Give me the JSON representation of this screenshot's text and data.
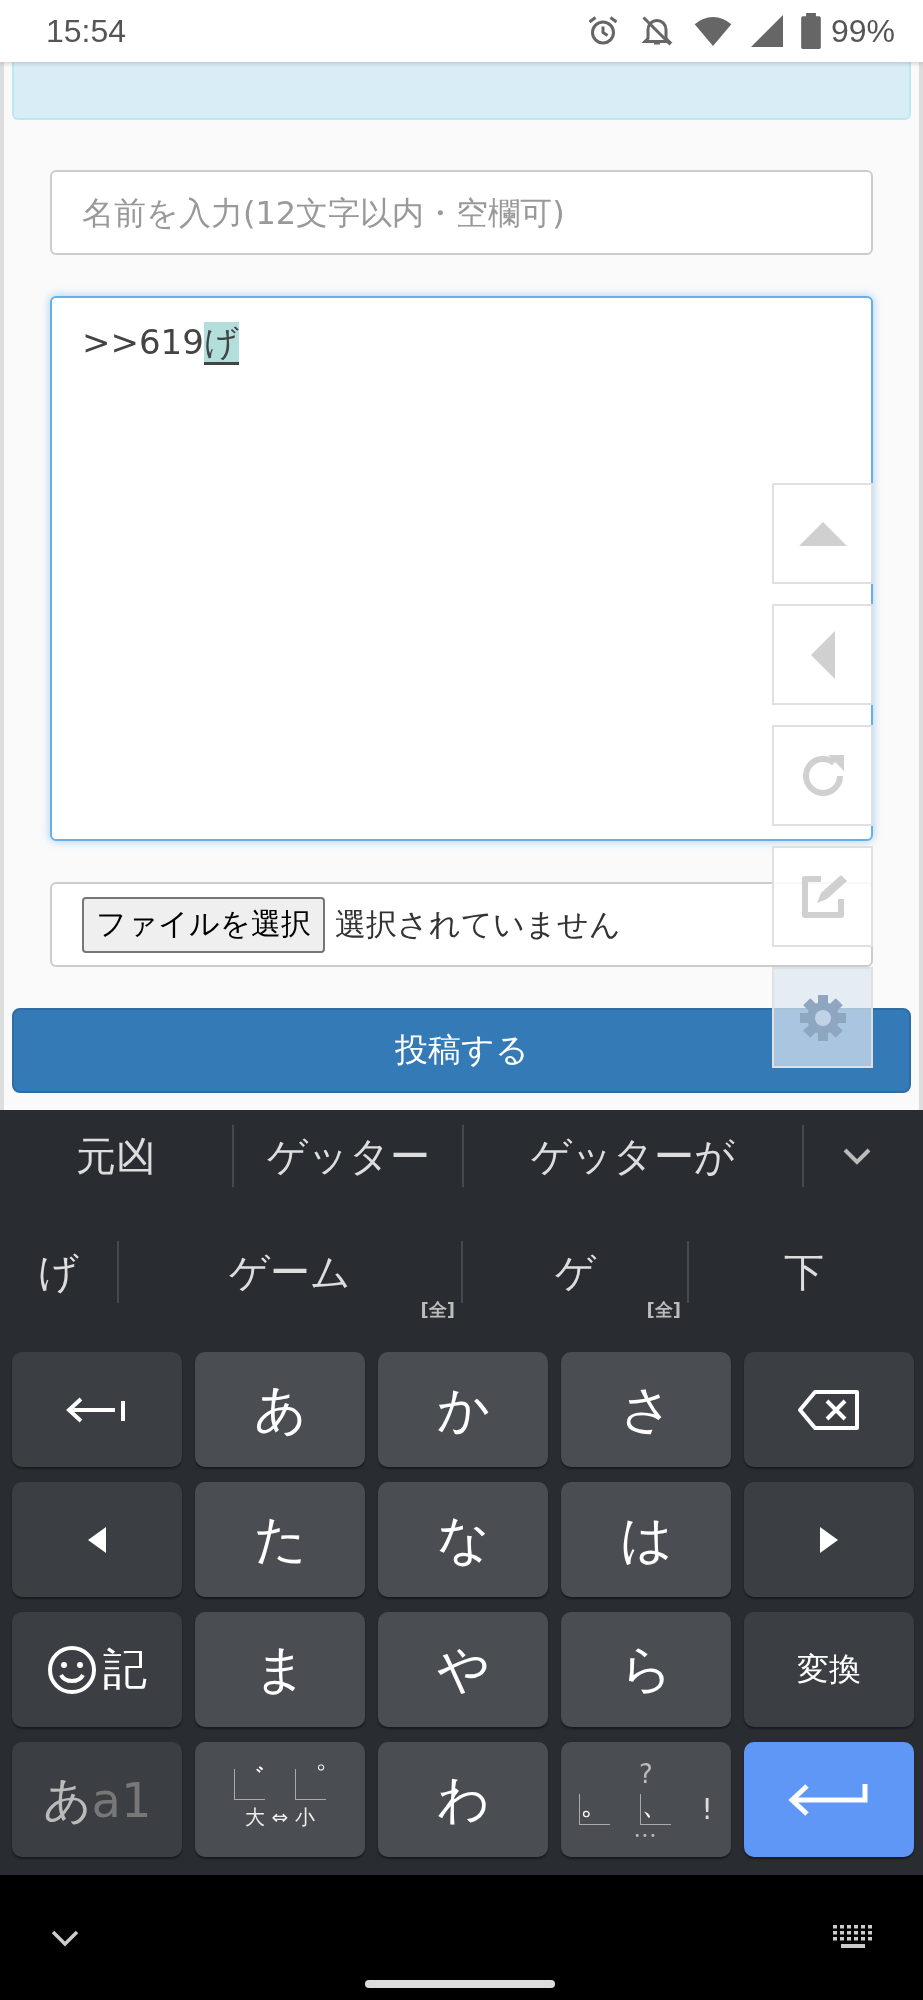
{
  "status_bar": {
    "time": "15:54",
    "battery": "99%"
  },
  "notice": {
    "kind": "info"
  },
  "form": {
    "name_placeholder": "名前を入力(12文字以内・空欄可)",
    "message": ">>619",
    "composing": "げ",
    "file_button": "ファイルを選択",
    "file_status": "選択されていません",
    "submit": "投稿する"
  },
  "side_buttons": [
    {
      "kind": "up"
    },
    {
      "kind": "back"
    },
    {
      "kind": "reload"
    },
    {
      "kind": "edit"
    },
    {
      "kind": "settings"
    }
  ],
  "keyboard": {
    "candidates": [
      "元凶",
      "ゲッター",
      "ゲッターが"
    ],
    "conversions": [
      {
        "text": "げ"
      },
      {
        "text": "ゲーム",
        "tag": "[全]"
      },
      {
        "text": "ゲ",
        "tag": "[全]"
      },
      {
        "text": "下"
      }
    ],
    "keys": [
      {
        "kind": "cursor-back"
      },
      {
        "kind": "char",
        "label": "あ"
      },
      {
        "kind": "char",
        "label": "か"
      },
      {
        "kind": "char",
        "label": "さ"
      },
      {
        "kind": "backspace"
      },
      {
        "kind": "left"
      },
      {
        "kind": "char",
        "label": "た"
      },
      {
        "kind": "char",
        "label": "な"
      },
      {
        "kind": "char",
        "label": "は"
      },
      {
        "kind": "right"
      },
      {
        "kind": "emoji",
        "label": "記"
      },
      {
        "kind": "char",
        "label": "ま"
      },
      {
        "kind": "char",
        "label": "や"
      },
      {
        "kind": "char",
        "label": "ら"
      },
      {
        "kind": "small",
        "label": "変換"
      },
      {
        "kind": "mode",
        "label": "あ",
        "sub": "a1"
      },
      {
        "kind": "dakuten",
        "marks": [
          "゛",
          "゜"
        ],
        "label": "大 ⇔ 小"
      },
      {
        "kind": "char",
        "label": "わ"
      },
      {
        "kind": "punct",
        "marks": [
          "?",
          "。",
          "、",
          "!",
          "•••"
        ]
      },
      {
        "kind": "enter"
      }
    ]
  }
}
